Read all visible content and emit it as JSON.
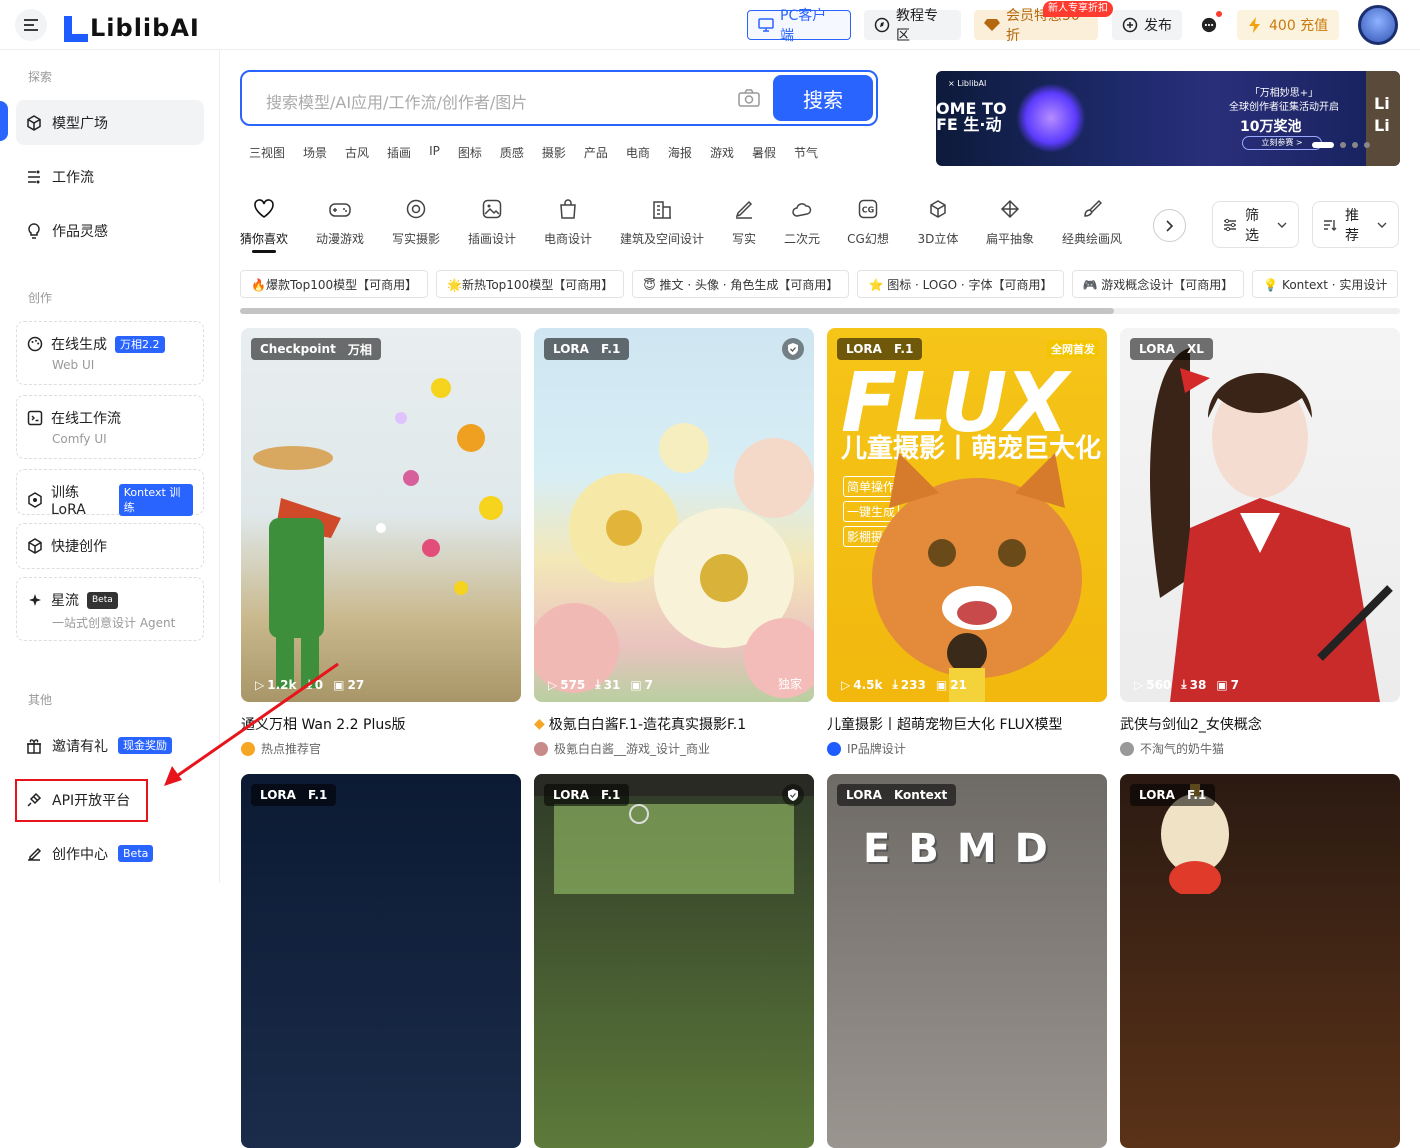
{
  "header": {
    "logo": "LiblibAI",
    "pc_client": "PC客户端",
    "tutorial": "教程专区",
    "vip": "会员特惠50折",
    "vip_badge": "新人专享折扣",
    "publish": "发布",
    "credits": "400 充值"
  },
  "sidebar": {
    "explore_title": "探索",
    "explore": [
      {
        "label": "模型广场",
        "icon": "cube-icon"
      },
      {
        "label": "工作流",
        "icon": "workflow-icon"
      },
      {
        "label": "作品灵感",
        "icon": "bulb-icon"
      }
    ],
    "create_title": "创作",
    "create": [
      {
        "label": "在线生成",
        "tag": "万相2.2",
        "sub": "Web UI"
      },
      {
        "label": "在线工作流",
        "sub": "Comfy UI"
      },
      {
        "label": "训练LoRA",
        "tag": "Kontext 训练"
      },
      {
        "label": "快捷创作"
      },
      {
        "label": "星流",
        "tag": "Beta",
        "sub": "一站式创意设计 Agent"
      }
    ],
    "other_title": "其他",
    "other": [
      {
        "label": "邀请有礼",
        "tag": "现金奖励"
      },
      {
        "label": "API开放平台"
      },
      {
        "label": "创作中心",
        "tag": "Beta"
      }
    ]
  },
  "search": {
    "placeholder": "搜索模型/AI应用/工作流/创作者/图片",
    "button": "搜索",
    "hotwords": [
      "三视图",
      "场景",
      "古风",
      "插画",
      "IP",
      "图标",
      "质感",
      "摄影",
      "产品",
      "电商",
      "海报",
      "游戏",
      "暑假",
      "节气"
    ]
  },
  "banner": {
    "logo": "× LiblibAI",
    "left_text": "OME TO\nFE 生·动",
    "title": "「万相妙思+」\n全球创作者征集活动开启",
    "prize": "10万奖池",
    "button": "立刻参赛 >",
    "right_text": "Li\nLi"
  },
  "categories": [
    {
      "label": "猜你喜欢",
      "icon": "heart-icon"
    },
    {
      "label": "动漫游戏",
      "icon": "gamepad-icon"
    },
    {
      "label": "写实摄影",
      "icon": "camera-icon"
    },
    {
      "label": "插画设计",
      "icon": "image-icon"
    },
    {
      "label": "电商设计",
      "icon": "bag-icon"
    },
    {
      "label": "建筑及空间设计",
      "icon": "building-icon"
    },
    {
      "label": "写实",
      "icon": "pen-icon"
    },
    {
      "label": "二次元",
      "icon": "cloud-icon"
    },
    {
      "label": "CG幻想",
      "icon": "cg-icon"
    },
    {
      "label": "3D立体",
      "icon": "cube3d-icon"
    },
    {
      "label": "扁平抽象",
      "icon": "flat-icon"
    },
    {
      "label": "经典绘画风",
      "icon": "brush-icon"
    }
  ],
  "filters": {
    "filter": "筛选",
    "sort": "推荐"
  },
  "chips": [
    "🔥爆款Top100模型【可商用】",
    "🌟新热Top100模型【可商用】",
    "😇 推文 · 头像 · 角色生成【可商用】",
    "⭐ 图标 · LOGO · 字体【可商用】",
    "🎮 游戏概念设计【可商用】",
    "💡 Kontext · 实用设计"
  ],
  "models": [
    {
      "type": "Checkpoint",
      "base": "万相",
      "views": "1.2k",
      "downloads": "0",
      "images": "27",
      "name": "通义万相 Wan 2.2 Plus版",
      "author": "热点推荐官",
      "shield": false,
      "exclusive": "",
      "first": ""
    },
    {
      "type": "LORA",
      "base": "F.1",
      "views": "575",
      "downloads": "31",
      "images": "7",
      "name": "极氪白白酱F.1-造花真实摄影F.1",
      "author": "极氪白白酱__游戏_设计_商业",
      "shield": true,
      "exclusive": "独家",
      "first": ""
    },
    {
      "type": "LORA",
      "base": "F.1",
      "views": "4.5k",
      "downloads": "233",
      "images": "21",
      "name": "儿童摄影丨超萌宠物巨大化 FLUX模型",
      "author": "IP品牌设计",
      "shield": false,
      "exclusive": "",
      "first": "全网首发"
    },
    {
      "type": "LORA",
      "base": "XL",
      "views": "560",
      "downloads": "38",
      "images": "7",
      "name": "武侠与剑仙2_女侠概念",
      "author": "不淘气的奶牛猫",
      "shield": false,
      "exclusive": "",
      "first": ""
    },
    {
      "type": "LORA",
      "base": "F.1"
    },
    {
      "type": "LORA",
      "base": "F.1"
    },
    {
      "type": "LORA",
      "base": "Kontext"
    },
    {
      "type": "LORA",
      "base": "F.1"
    }
  ],
  "flux_card": {
    "title": "FLUX",
    "subtitle": "儿童摄影丨萌宠巨大化",
    "pills": [
      "简单操作",
      "一键生成",
      "影棚摄影"
    ]
  },
  "kontext_card": {
    "letters": "EBMD"
  }
}
